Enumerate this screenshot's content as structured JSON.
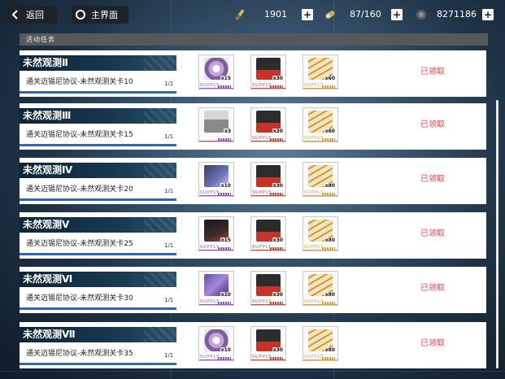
{
  "topbar": {
    "back_label": "返回",
    "home_label": "主界面",
    "resources": [
      {
        "icon": "key-icon",
        "value": "1901"
      },
      {
        "icon": "stamina-capsule-icon",
        "value": "87/160"
      },
      {
        "icon": "coin-icon",
        "value": "8271186"
      }
    ]
  },
  "section": {
    "title": "活动任务"
  },
  "tasks": [
    {
      "title": "未然观测Ⅱ",
      "desc": "通关迈锡尼协议-未然观测关卡10",
      "progress": "1/1",
      "status": "已领取",
      "rewards": [
        {
          "icon": "disc-item-icon",
          "tag": "SUPPLY",
          "count": "x15",
          "rarity": "purple"
        },
        {
          "icon": "supply-box-red-icon",
          "tag": "SUPPLY",
          "count": "x30",
          "rarity": "red"
        },
        {
          "icon": "ticket-gold-icon",
          "tag": "SUPPLY",
          "count": "x60",
          "rarity": "gold"
        }
      ]
    },
    {
      "title": "未然观测Ⅲ",
      "desc": "通关迈锡尼协议-未然观测关卡15",
      "progress": "1/1",
      "status": "已领取",
      "rewards": [
        {
          "icon": "gray-crate-icon",
          "tag": "",
          "count": "x3",
          "rarity": "purple"
        },
        {
          "icon": "supply-box-red-icon",
          "tag": "SUPPLY",
          "count": "x20",
          "rarity": "red"
        },
        {
          "icon": "ticket-gold-icon",
          "tag": "SUPPLY",
          "count": "x60",
          "rarity": "gold"
        }
      ]
    },
    {
      "title": "未然观测Ⅳ",
      "desc": "通关迈锡尼协议-未然观测关卡20",
      "progress": "1/1",
      "status": "已领取",
      "rewards": [
        {
          "icon": "chip-item-icon",
          "tag": "SUPPLY",
          "count": "x10",
          "rarity": "purple"
        },
        {
          "icon": "supply-box-red-icon",
          "tag": "SUPPLY",
          "count": "x30",
          "rarity": "red"
        },
        {
          "icon": "ticket-gold-icon",
          "tag": "SUPPLY",
          "count": "x80",
          "rarity": "gold"
        }
      ]
    },
    {
      "title": "未然观测Ⅴ",
      "desc": "通关迈锡尼协议-未然观测关卡25",
      "progress": "1/1",
      "status": "已领取",
      "rewards": [
        {
          "icon": "black-device-icon",
          "tag": "SUPPLY",
          "count": "x15",
          "rarity": "purple"
        },
        {
          "icon": "supply-box-red-icon",
          "tag": "SUPPLY",
          "count": "x30",
          "rarity": "red"
        },
        {
          "icon": "ticket-gold-icon",
          "tag": "SUPPLY",
          "count": "x80",
          "rarity": "gold"
        }
      ]
    },
    {
      "title": "未然观测Ⅵ",
      "desc": "通关迈锡尼协议-未然观测关卡30",
      "progress": "1/1",
      "status": "已领取",
      "rewards": [
        {
          "icon": "capsule-item-icon",
          "tag": "SUPPLY",
          "count": "x10",
          "rarity": "purple"
        },
        {
          "icon": "supply-box-red-icon",
          "tag": "SUPPLY",
          "count": "x30",
          "rarity": "red"
        },
        {
          "icon": "ticket-gold-icon",
          "tag": "SUPPLY",
          "count": "x80",
          "rarity": "gold"
        }
      ]
    },
    {
      "title": "未然观测Ⅶ",
      "desc": "通关迈锡尼协议-未然观测关卡35",
      "progress": "1/1",
      "status": "已领取",
      "rewards": [
        {
          "icon": "disc-item-icon",
          "tag": "SUPPLY",
          "count": "x10",
          "rarity": "purple"
        },
        {
          "icon": "supply-box-red-icon",
          "tag": "SUPPLY",
          "count": "x30",
          "rarity": "red"
        },
        {
          "icon": "ticket-gold-icon",
          "tag": "SUPPLY",
          "count": "x80",
          "rarity": "gold"
        }
      ]
    }
  ],
  "colors": {
    "status": "#e0474c",
    "progress_bar": "#2e67b3",
    "rarity_purple": "#9a4fd6",
    "rarity_red": "#d9463e",
    "rarity_gold": "#e0a33a"
  }
}
